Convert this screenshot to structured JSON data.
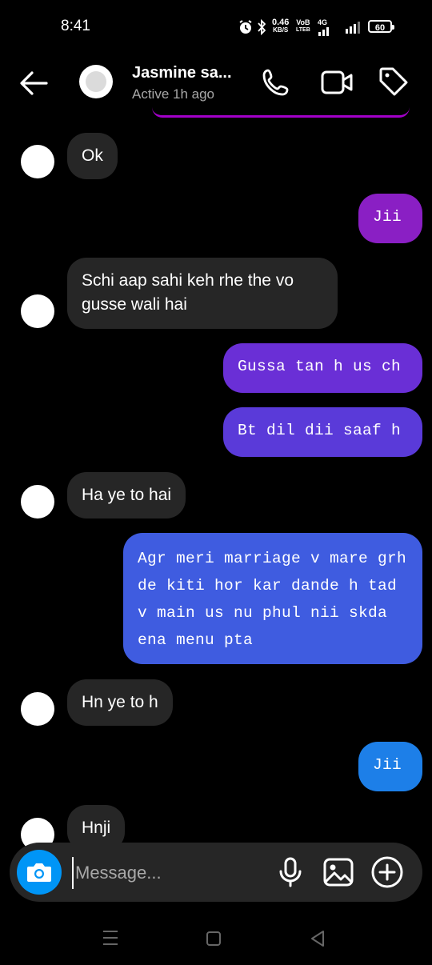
{
  "status_bar": {
    "time": "8:41",
    "net_speed_value": "0.46",
    "net_speed_unit": "KB/S",
    "volte_top": "VoB",
    "volte_bottom": "LTEB",
    "network": "4G",
    "battery": "60"
  },
  "header": {
    "contact_name": "Jasmine sa...",
    "contact_status": "Active 1h ago"
  },
  "messages": [
    {
      "dir": "in",
      "text": "Ok"
    },
    {
      "dir": "out",
      "text": "Jii",
      "color": "#8a1fc4"
    },
    {
      "dir": "in",
      "text": "Schi aap sahi keh rhe the vo gusse wali hai"
    },
    {
      "dir": "out",
      "text": "Gussa tan h us ch",
      "color": "#6a2fd6"
    },
    {
      "dir": "out",
      "text": "Bt dil dii saaf h",
      "color": "#5a3ad9"
    },
    {
      "dir": "in",
      "text": "Ha ye to hai"
    },
    {
      "dir": "out",
      "text": "Agr meri marriage v mare grh de kiti hor kar dande h tad v main us nu phul nii skda ena menu pta",
      "color": "#3f5ce0"
    },
    {
      "dir": "in",
      "text": "Hn ye to h"
    },
    {
      "dir": "out",
      "text": "Jii",
      "color": "#1d7fe8"
    },
    {
      "dir": "in",
      "text": "Hnji"
    }
  ],
  "composer": {
    "placeholder": "Message..."
  },
  "colors": {
    "background": "#000000",
    "incoming_bubble": "#262626",
    "camera_button": "#0095f6"
  },
  "icons": [
    "back-arrow-icon",
    "phone-icon",
    "video-camera-icon",
    "tag-icon",
    "camera-icon",
    "microphone-icon",
    "gallery-icon",
    "plus-icon"
  ]
}
